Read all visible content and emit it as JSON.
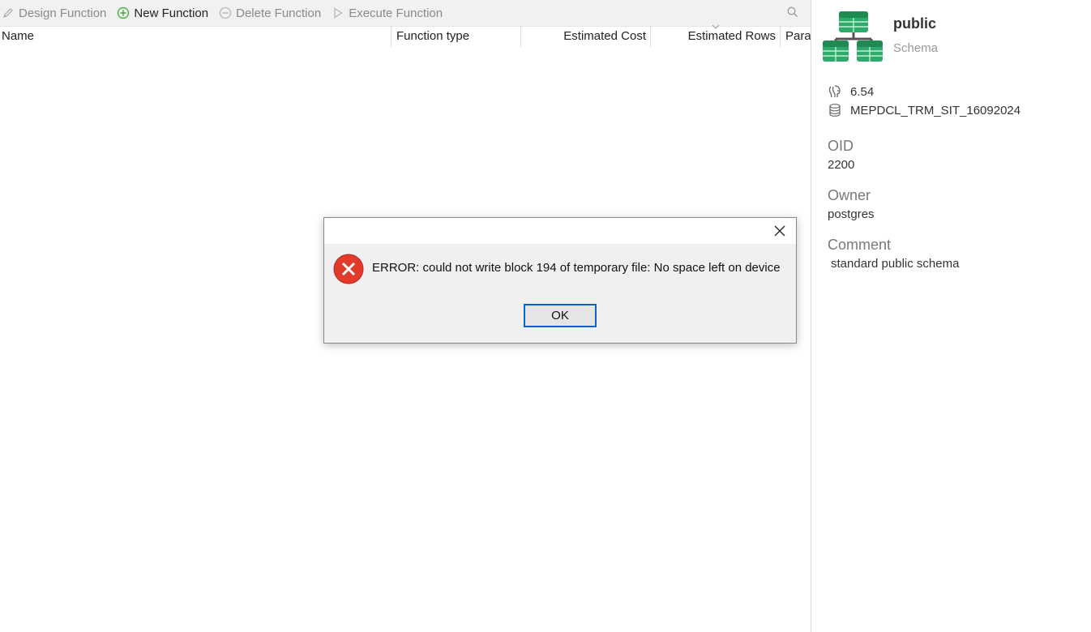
{
  "toolbar": {
    "design_function": "Design Function",
    "new_function": "New Function",
    "delete_function": "Delete Function",
    "execute_function": "Execute Function"
  },
  "columns": {
    "name": "Name",
    "function_type": "Function type",
    "estimated_cost": "Estimated Cost",
    "estimated_rows": "Estimated Rows",
    "parameters": "Parar"
  },
  "info": {
    "name": "public",
    "type": "Schema",
    "server_version": "6.54",
    "database": "MEPDCL_TRM_SIT_16092024",
    "oid_label": "OID",
    "oid_value": "2200",
    "owner_label": "Owner",
    "owner_value": "postgres",
    "comment_label": "Comment",
    "comment_value": "standard public schema"
  },
  "dialog": {
    "message": "ERROR:  could not write block 194 of temporary file: No space left on device",
    "ok_label": "OK"
  },
  "colors": {
    "error_red": "#e23b2b",
    "new_green": "#3aa935",
    "schema_green": "#2eaa6a",
    "focus_blue": "#0a64c8"
  }
}
